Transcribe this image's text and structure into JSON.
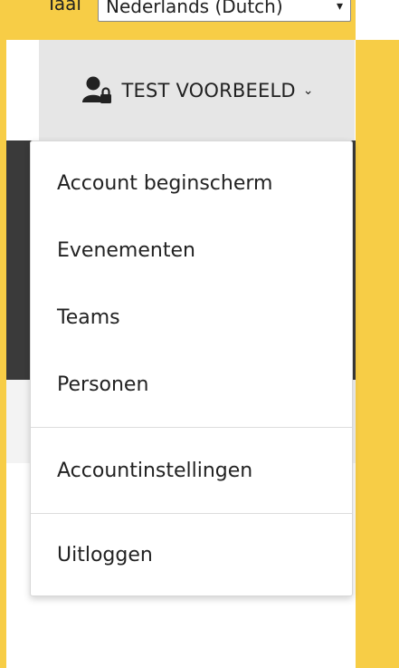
{
  "language": {
    "label": "Taal",
    "selected": "Nederlands (Dutch)"
  },
  "account": {
    "name": "TEST VOORBEELD",
    "icon": "user-lock-icon",
    "chevron": "chevron-down-icon"
  },
  "menu": {
    "items": [
      {
        "label": "Account beginscherm"
      },
      {
        "label": "Evenementen"
      },
      {
        "label": "Teams"
      },
      {
        "label": "Personen"
      },
      {
        "label": "Accountinstellingen"
      },
      {
        "label": "Uitloggen"
      }
    ]
  },
  "colors": {
    "frame": "#f7cd46",
    "button_bg": "#e6e6e6",
    "dark_band": "#3a3a3a"
  }
}
